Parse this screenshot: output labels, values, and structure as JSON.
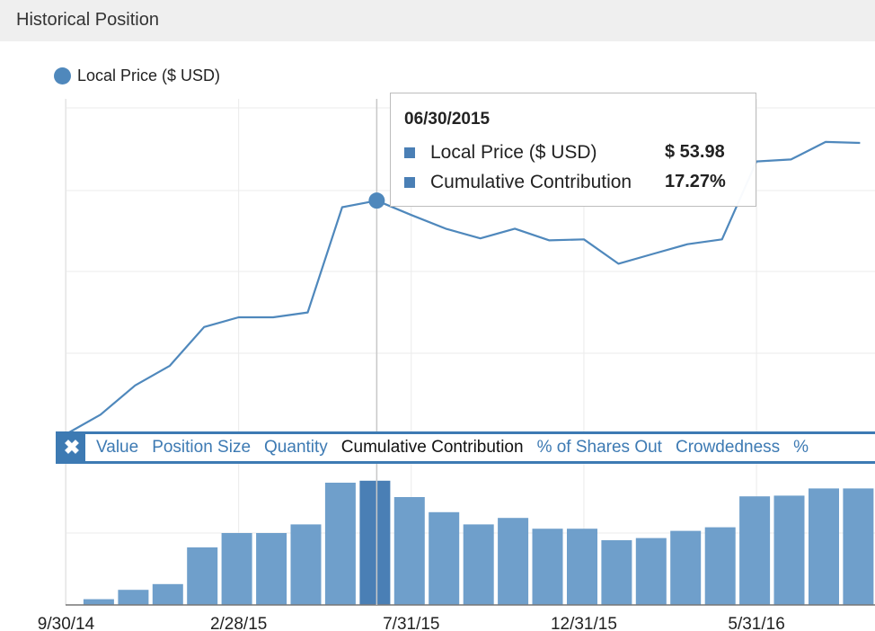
{
  "panel": {
    "title": "Historical Position"
  },
  "legend": {
    "label": "Local Price ($ USD)",
    "color": "#4f88bc"
  },
  "tooltip": {
    "date": "06/30/2015",
    "rows": [
      {
        "label": "Local Price ($ USD)",
        "value": "$ 53.98"
      },
      {
        "label": "Cumulative Contribution",
        "value": "17.27%"
      }
    ]
  },
  "metrics": {
    "close_icon": "close-icon",
    "active": "Cumulative Contribution",
    "tabs": [
      "Value",
      "Position Size",
      "Quantity",
      "Cumulative Contribution",
      "% of Shares Out",
      "Crowdedness",
      "%"
    ]
  },
  "chart_data": [
    {
      "type": "line",
      "series": [
        {
          "name": "Local Price ($ USD)",
          "color": "#4f88bc",
          "x": [
            "9/30/14",
            "10/31/14",
            "11/30/14",
            "12/31/14",
            "1/31/15",
            "2/28/15",
            "3/31/15",
            "4/30/15",
            "5/31/15",
            "6/30/15",
            "7/31/15",
            "8/31/15",
            "9/30/15",
            "10/31/15",
            "11/30/15",
            "12/31/15",
            "1/31/16",
            "2/29/16",
            "3/31/16",
            "4/30/16",
            "5/31/16",
            "6/30/16",
            "7/31/16",
            "8/31/16"
          ],
          "values": [
            30.0,
            32.0,
            35.0,
            37.0,
            41.0,
            42.0,
            42.0,
            42.5,
            53.3,
            53.98,
            52.5,
            51.1,
            50.1,
            51.1,
            49.9,
            50.0,
            47.5,
            48.5,
            49.5,
            50.0,
            58.0,
            58.2,
            60.0,
            59.9
          ]
        }
      ],
      "xtick_labels": [
        "9/30/14",
        "2/28/15",
        "7/31/15",
        "12/31/15",
        "5/31/16"
      ],
      "highlight": {
        "x": "6/30/15",
        "value": 53.98
      },
      "grid": true,
      "legend": "top-left"
    },
    {
      "type": "bar",
      "series": [
        {
          "name": "Cumulative Contribution",
          "color": "#6f9fcb",
          "highlight_color": "#4a7fb5",
          "categories": [
            "10/31/14",
            "11/30/14",
            "12/31/14",
            "1/31/15",
            "2/28/15",
            "3/31/15",
            "4/30/15",
            "5/31/15",
            "6/30/15",
            "7/31/15",
            "8/31/15",
            "9/30/15",
            "10/31/15",
            "11/30/15",
            "12/31/15",
            "1/31/16",
            "2/29/16",
            "3/31/16",
            "4/30/16",
            "5/31/16",
            "6/30/16",
            "7/31/16",
            "8/31/16"
          ],
          "values": [
            0.8,
            2.1,
            2.9,
            8.0,
            10.0,
            10.0,
            11.2,
            17.0,
            17.27,
            15.0,
            12.9,
            11.2,
            12.1,
            10.6,
            10.6,
            9.0,
            9.3,
            10.3,
            10.8,
            15.1,
            15.2,
            16.2,
            16.2
          ],
          "highlight_index": 8
        }
      ],
      "grid": true
    }
  ]
}
